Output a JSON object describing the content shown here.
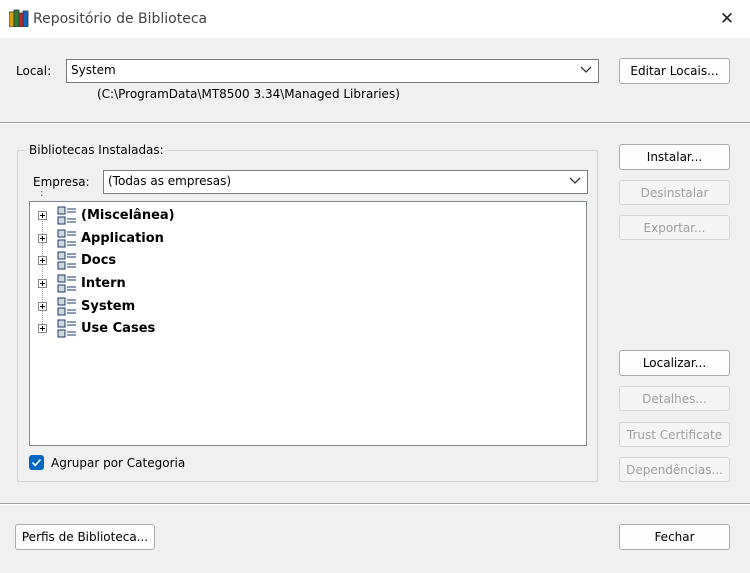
{
  "window": {
    "title": "Repositório de Biblioteca"
  },
  "local": {
    "label": "Local:",
    "value": "System",
    "path": "(C:\\ProgramData\\MT8500 3.34\\Managed Libraries)",
    "edit_button": "Editar Locais..."
  },
  "installed": {
    "group_title": "Bibliotecas Instaladas:",
    "company_label": "Empresa:",
    "company_value": "(Todas as empresas)",
    "items": [
      {
        "label": "(Miscelânea)"
      },
      {
        "label": "Application"
      },
      {
        "label": "Docs"
      },
      {
        "label": "Intern"
      },
      {
        "label": "System"
      },
      {
        "label": "Use Cases"
      }
    ],
    "group_by_category_label": "Agrupar por Categoria",
    "group_by_category_checked": true
  },
  "actions": {
    "install": "Instalar...",
    "uninstall": "Desinstalar",
    "export": "Exportar...",
    "locate": "Localizar...",
    "details": "Detalhes...",
    "trust_certificate": "Trust Certificate",
    "dependencies": "Dependências..."
  },
  "footer": {
    "profiles_button": "Perfis de Biblioteca...",
    "close_button": "Fechar"
  },
  "colors": {
    "accent": "#0067c0",
    "disabled_text": "#a0a0a0"
  }
}
